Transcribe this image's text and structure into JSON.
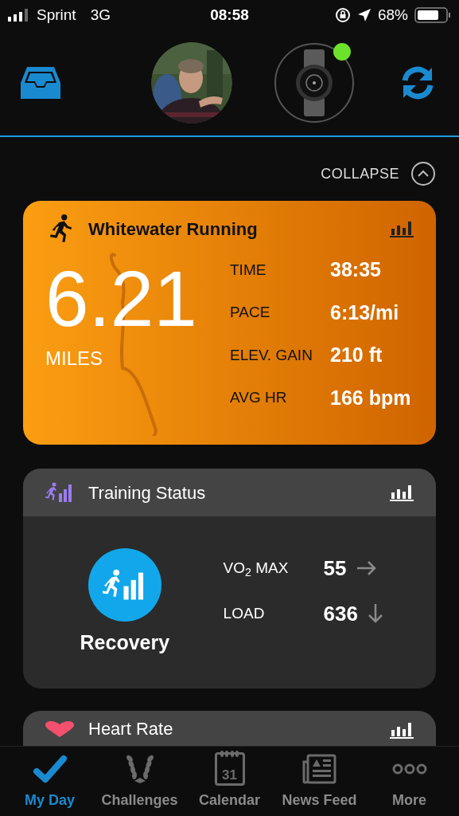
{
  "status_bar": {
    "carrier": "Sprint",
    "network": "3G",
    "time": "08:58",
    "battery": "68%"
  },
  "header": {
    "device_connected": true
  },
  "collapse": {
    "label": "COLLAPSE"
  },
  "activity": {
    "title": "Whitewater Running",
    "distance": "6.21",
    "unit": "MILES",
    "stats": [
      {
        "label": "TIME",
        "value": "38:35"
      },
      {
        "label": "PACE",
        "value": "6:13/mi"
      },
      {
        "label": "ELEV. GAIN",
        "value": "210 ft"
      },
      {
        "label": "AVG HR",
        "value": "166 bpm"
      }
    ]
  },
  "training": {
    "title": "Training Status",
    "status": "Recovery",
    "metrics": [
      {
        "label": "VO$_{2}$ MAX",
        "value": "55",
        "kind": "steady"
      },
      {
        "label": "LOAD",
        "value": "636",
        "kind": "down"
      }
    ]
  },
  "heart_rate": {
    "title": "Heart Rate"
  },
  "tabs": [
    {
      "label": "My Day",
      "kind": "check",
      "selected": true
    },
    {
      "label": "Challenges",
      "kind": "laurel",
      "selected": false
    },
    {
      "label": "Calendar",
      "kind": "calendar",
      "day": "31",
      "selected": false
    },
    {
      "label": "News Feed",
      "kind": "news",
      "selected": false
    },
    {
      "label": "More",
      "kind": "more",
      "selected": false
    }
  ]
}
